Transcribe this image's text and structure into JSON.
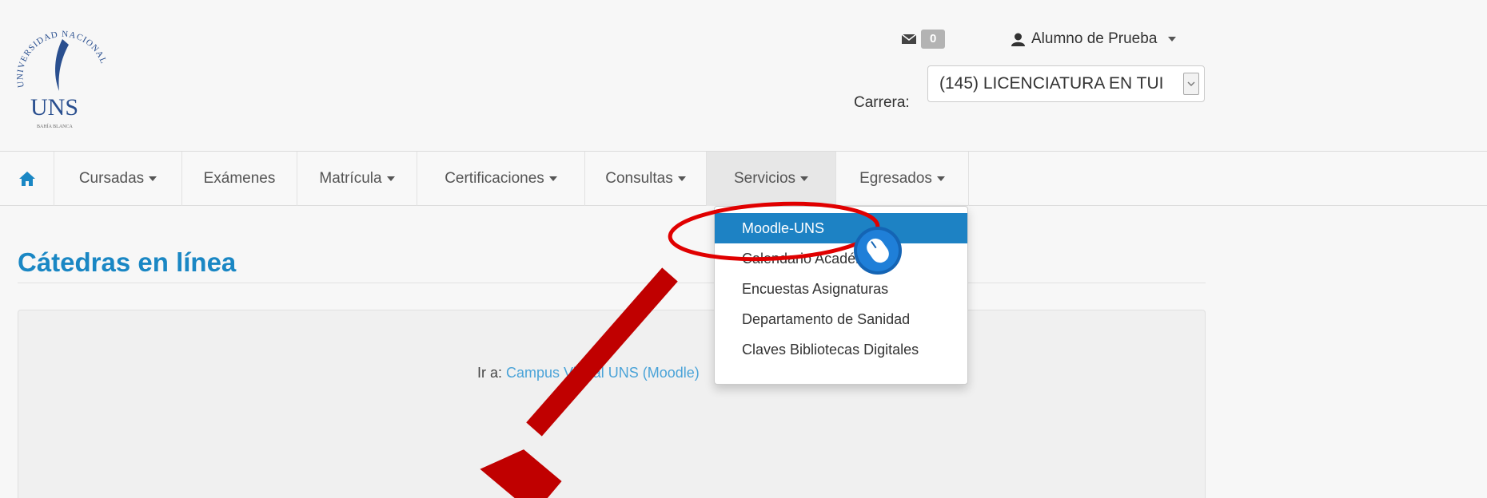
{
  "header": {
    "logo": {
      "arc_text": "UNIVERSIDAD NACIONAL DEL SUR",
      "abbr": "UNS",
      "city": "BAHÍA BLANCA"
    },
    "messages": {
      "icon": "envelope-icon",
      "count": "0"
    },
    "user": {
      "icon": "user-icon",
      "name": "Alumno de Prueba"
    },
    "carrera": {
      "label": "Carrera:",
      "selected": "(145) LICENCIATURA EN TUI"
    }
  },
  "navbar": {
    "home_icon": "home-icon",
    "items": [
      {
        "label": "Cursadas",
        "has_caret": true
      },
      {
        "label": "Exámenes",
        "has_caret": false
      },
      {
        "label": "Matrícula",
        "has_caret": true
      },
      {
        "label": "Certificaciones",
        "has_caret": true
      },
      {
        "label": "Consultas",
        "has_caret": true
      },
      {
        "label": "Servicios",
        "has_caret": true,
        "active": true
      },
      {
        "label": "Egresados",
        "has_caret": true
      }
    ]
  },
  "dropdown": {
    "items": [
      {
        "label": "Moodle-UNS",
        "highlighted": true
      },
      {
        "label": "Calendario Académico"
      },
      {
        "label": "Encuestas Asignaturas"
      },
      {
        "label": "Departamento de Sanidad"
      },
      {
        "label": "Claves Bibliotecas Digitales"
      }
    ]
  },
  "main": {
    "title": "Cátedras en línea",
    "panel": {
      "prefix": "Ir a:",
      "link": "Campus Virtual UNS (Moodle)"
    }
  },
  "annotations": {
    "highlight_color": "#e00000",
    "arrow_color": "#c00000",
    "cursor_icon": "mouse-click-icon"
  },
  "colors": {
    "accent": "#1a87c4",
    "menu_hover": "#1d82c4",
    "link": "#4aa3d8"
  }
}
